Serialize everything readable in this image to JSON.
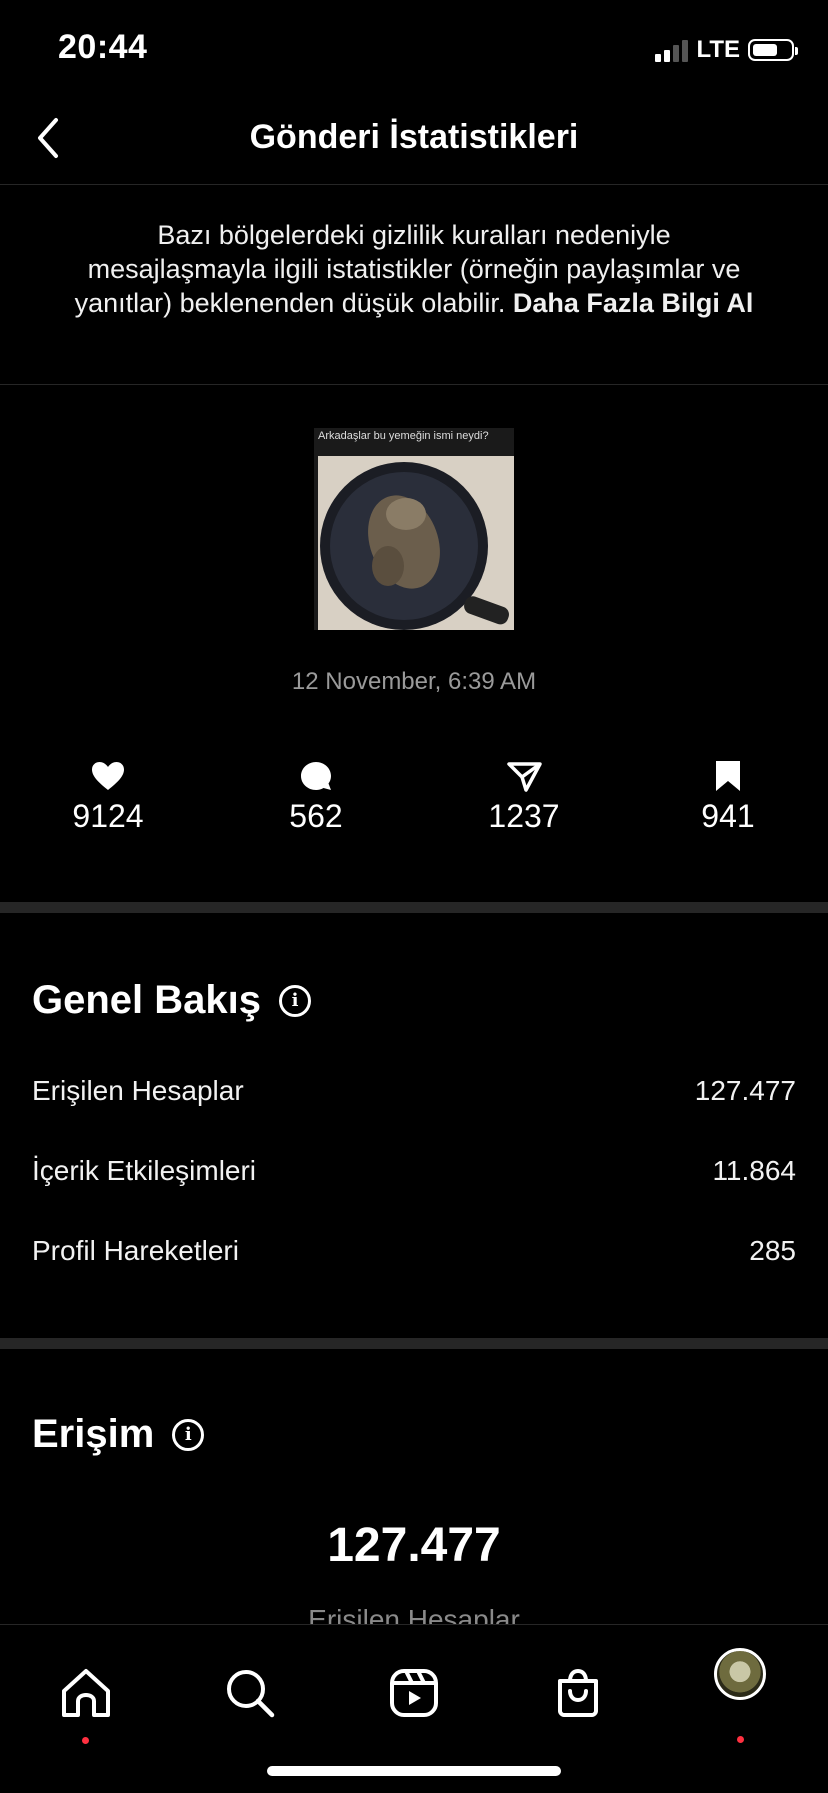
{
  "status_bar": {
    "time": "20:44",
    "network": "LTE",
    "icons": [
      "signal-icon",
      "battery-icon"
    ]
  },
  "header": {
    "title": "Gönderi İstatistikleri",
    "back_icon": "chevron-left-icon"
  },
  "notice": {
    "text": "Bazı bölgelerdeki gizlilik kuralları nedeniyle mesajlaşmayla ilgili istatistikler (örneğin paylaşımlar ve yanıtlar) beklenenden düşük olabilir. ",
    "link": "Daha Fazla Bilgi Al"
  },
  "post": {
    "caption": "Arkadaşlar bu yemeğin ismi neydi?",
    "date": "12 November, 6:39 AM"
  },
  "stats": [
    {
      "icon": "heart-icon",
      "value": "9124"
    },
    {
      "icon": "comment-icon",
      "value": "562"
    },
    {
      "icon": "share-icon",
      "value": "1237"
    },
    {
      "icon": "bookmark-icon",
      "value": "941"
    }
  ],
  "overview": {
    "title": "Genel Bakış",
    "rows": [
      {
        "label": "Erişilen Hesaplar",
        "value": "127.477"
      },
      {
        "label": "İçerik Etkileşimleri",
        "value": "11.864"
      },
      {
        "label": "Profil Hareketleri",
        "value": "285"
      }
    ]
  },
  "reach": {
    "title": "Erişim",
    "value": "127.477",
    "subtitle": "Erişilen Hesaplar"
  },
  "tabbar": {
    "items": [
      "home-icon",
      "search-icon",
      "reels-icon",
      "shop-icon",
      "profile-avatar"
    ],
    "dot_color": "#ff3040"
  }
}
